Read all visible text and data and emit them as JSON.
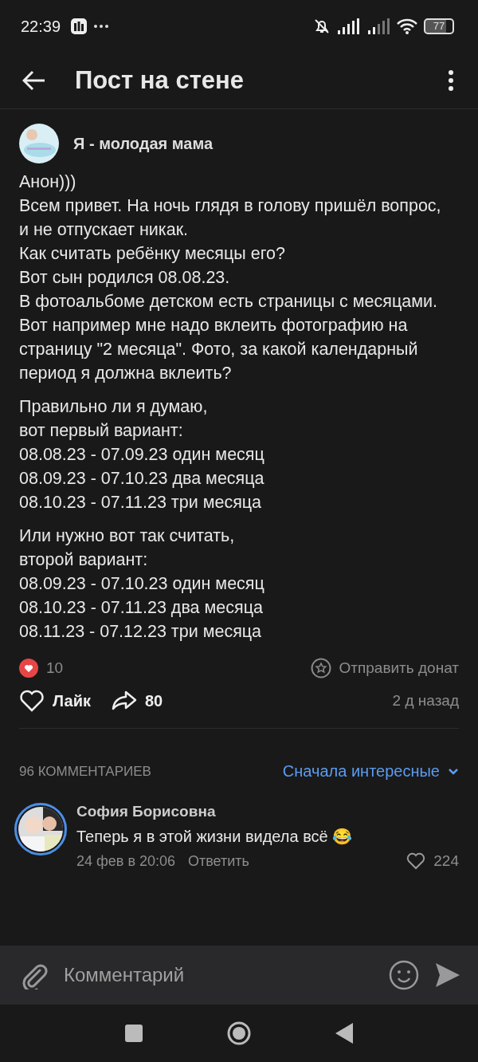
{
  "status_bar": {
    "time": "22:39",
    "battery": "77"
  },
  "header": {
    "title": "Пост на стене"
  },
  "post": {
    "author": "Я - молодая мама",
    "paragraphs": [
      "Анон)))\nВсем привет. На ночь глядя в голову пришёл вопрос, и не отпускает никак.\nКак считать ребёнку месяцы его?\nВот сын родился 08.08.23.\nВ фотоальбоме детском есть страницы с месяцами.\nВот например мне надо вклеить фотографию на страницу \"2 месяца\". Фото, за какой календарный период я должна вклеить?",
      "Правильно ли я думаю,\nвот первый вариант:\n08.08.23 - 07.09.23 один месяц\n08.09.23 - 07.10.23 два месяца\n08.10.23 - 07.11.23 три месяца",
      "Или нужно вот так считать,\nвторой вариант:\n08.09.23 - 07.10.23 один месяц\n08.10.23 - 07.11.23 два месяца\n08.11.23 - 07.12.23 три месяца"
    ],
    "reactions_count": "10",
    "donate": "Отправить донат",
    "like_label": "Лайк",
    "liked": false,
    "shares": "80",
    "time": "2 д назад"
  },
  "comments": {
    "count_label": "96 КОММЕНТАРИЕВ",
    "sort": "Сначала интересные",
    "items": [
      {
        "author": "София Борисовна",
        "text": "Теперь я в этой жизни видела всё 😂",
        "date": "24 фев в 20:06",
        "reply": "Ответить",
        "likes": "224",
        "liked": false
      }
    ]
  },
  "composer": {
    "placeholder": "Комментарий"
  }
}
